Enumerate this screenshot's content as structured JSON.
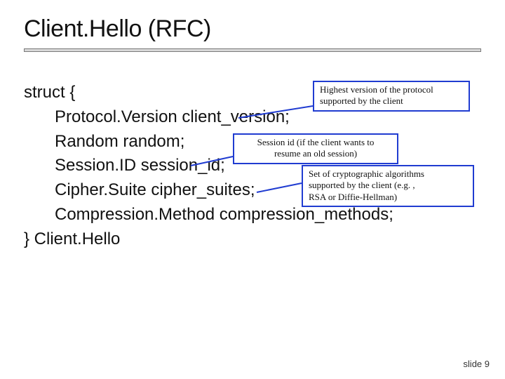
{
  "title": "Client.Hello (RFC)",
  "code": {
    "l1": "struct {",
    "l2": "Protocol.Version client_version;",
    "l3": "Random random;",
    "l4": "Session.ID session_id;",
    "l5": "Cipher.Suite cipher_suites;",
    "l6": "Compression.Method compression_methods;",
    "l7": "} Client.Hello"
  },
  "callouts": {
    "c1a": "Highest version of the protocol",
    "c1b": "supported by the client",
    "c2a": "Session id (if the client wants to",
    "c2b": "resume an old session)",
    "c3a": "Set of cryptographic algorithms",
    "c3b": "supported by the client (e.g. ,",
    "c3c": "RSA or Diffie-Hellman)"
  },
  "footer": "slide 9",
  "colors": {
    "callout_border": "#203cd1",
    "rule_fill": "#d9d9d9"
  }
}
